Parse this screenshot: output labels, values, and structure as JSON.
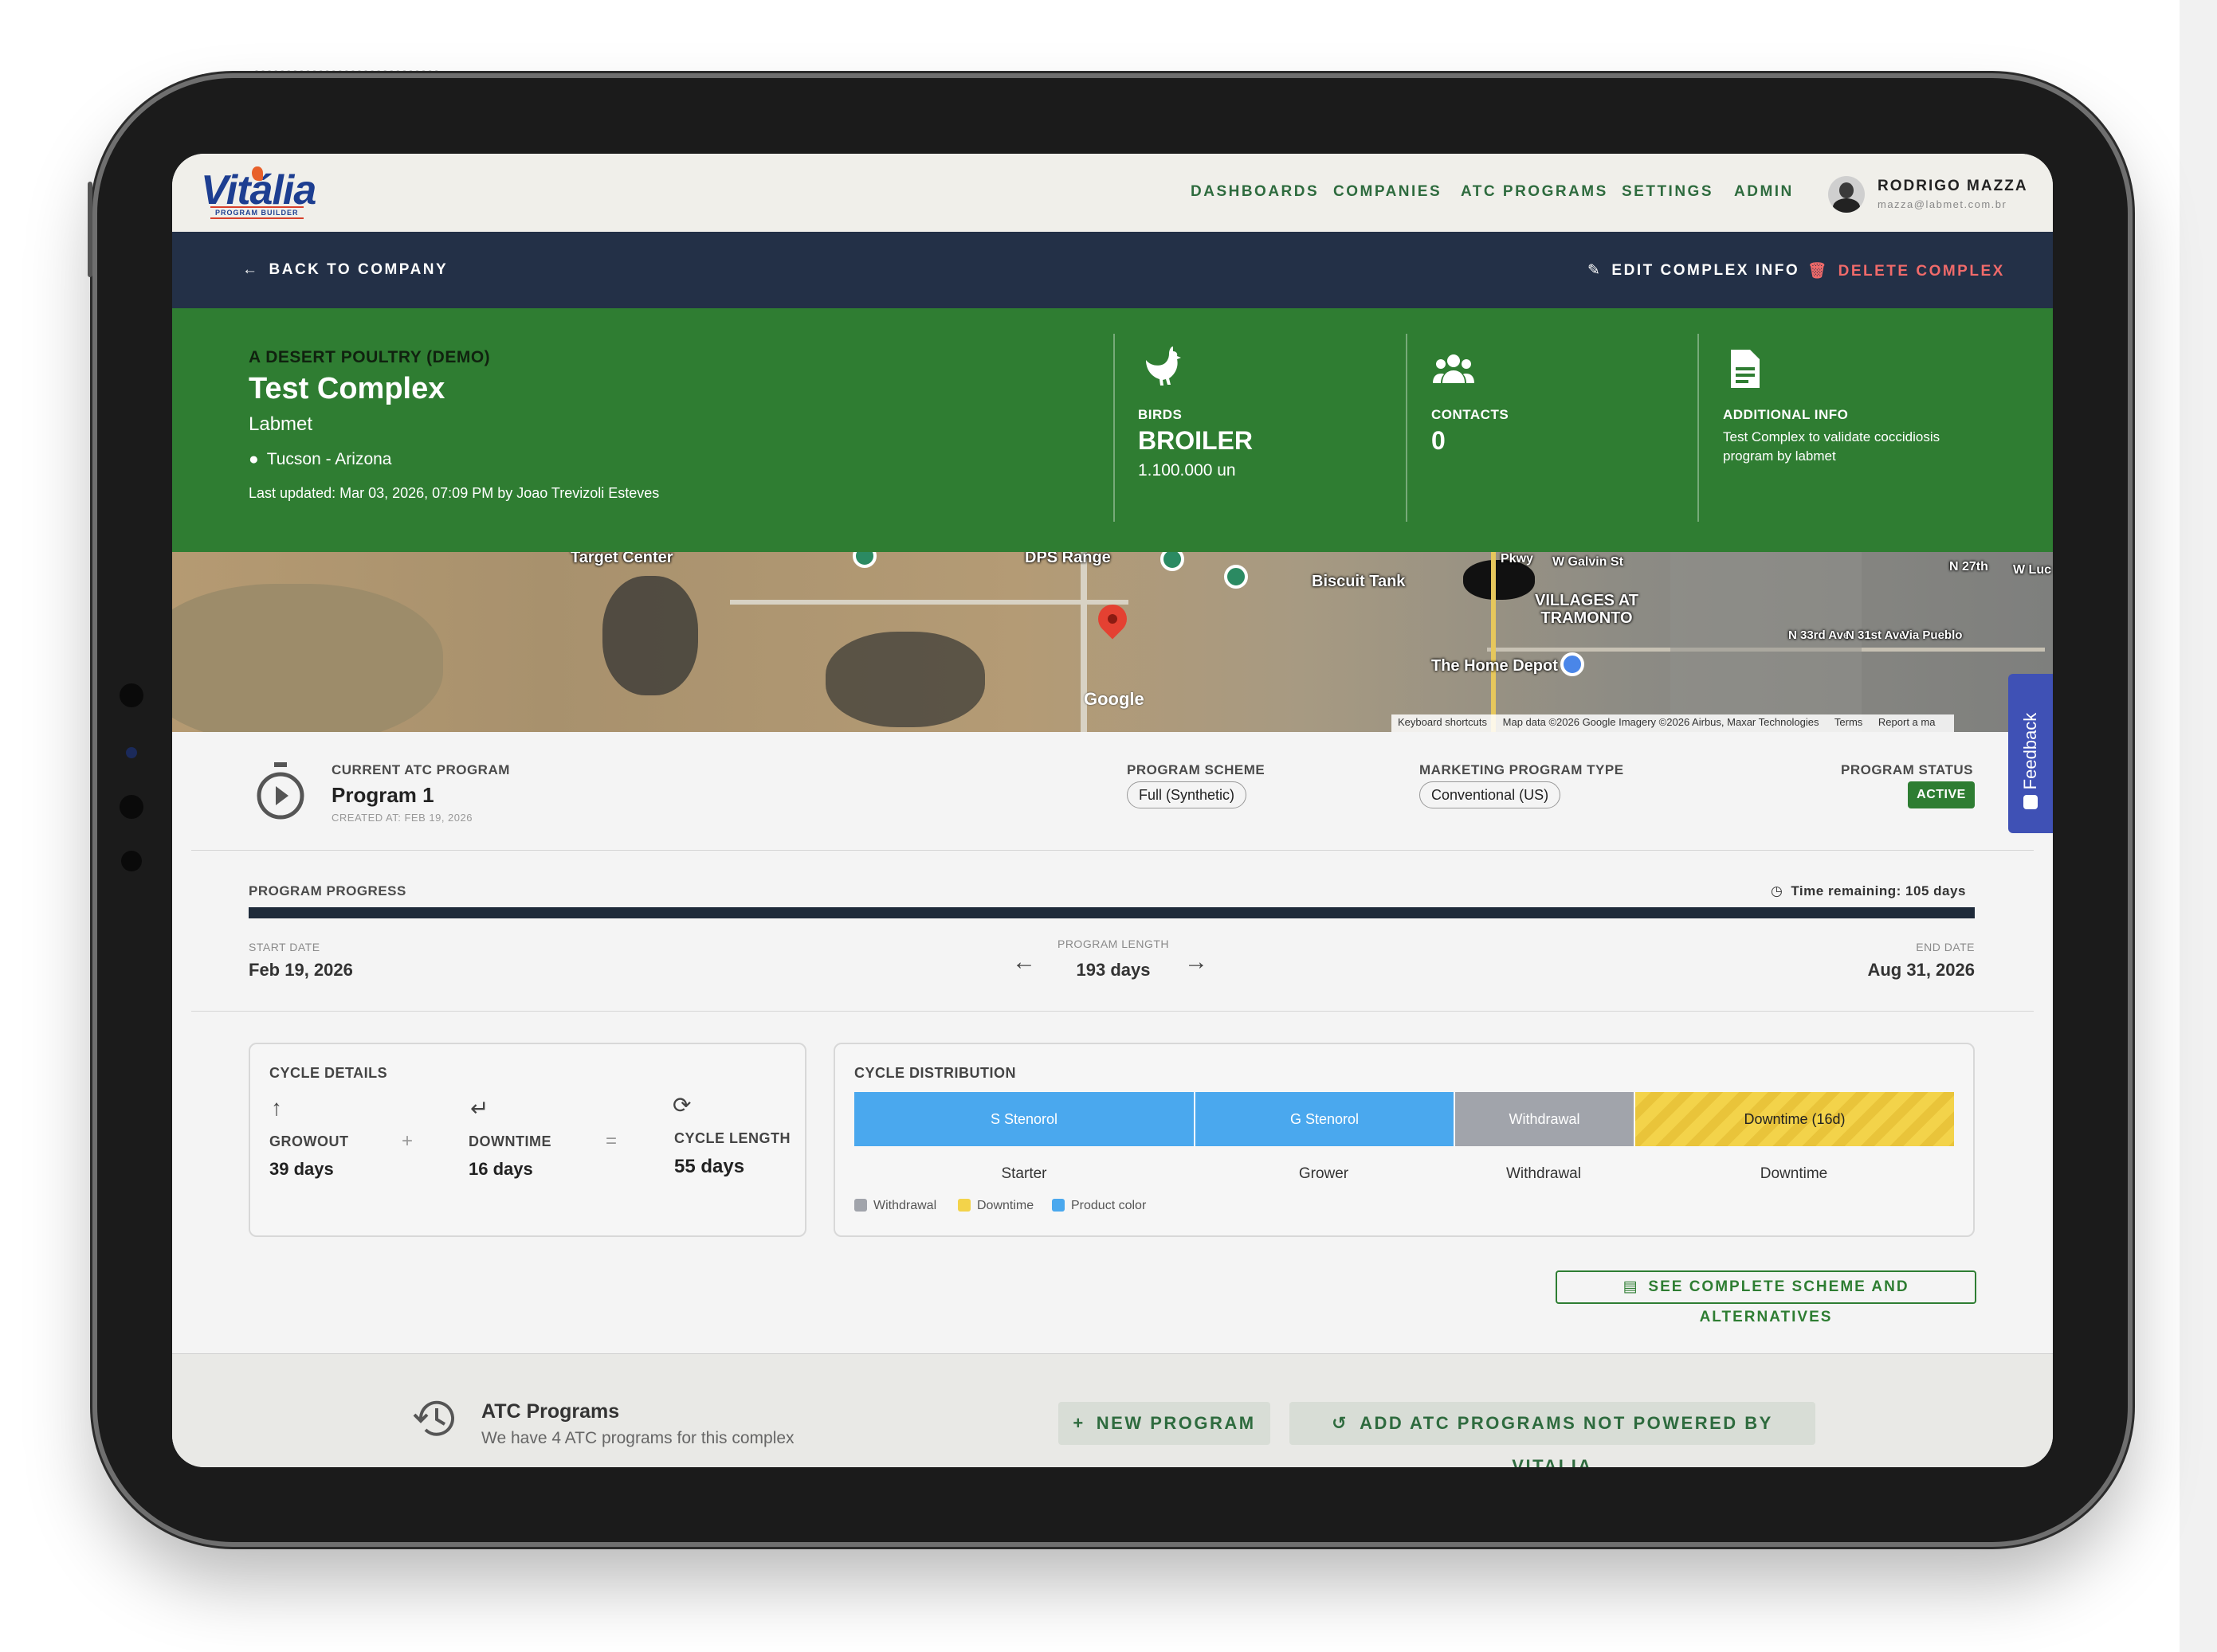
{
  "header": {
    "logo_text": "Vitália",
    "logo_sub": "PROGRAM BUILDER",
    "nav": [
      "DASHBOARDS",
      "COMPANIES",
      "ATC PROGRAMS",
      "SETTINGS",
      "ADMIN"
    ],
    "user_name": "RODRIGO MAZZA",
    "user_email": "mazza@labmet.com.br"
  },
  "actionbar": {
    "back": "BACK TO COMPANY",
    "edit": "EDIT COMPLEX INFO",
    "delete": "DELETE COMPLEX"
  },
  "complex": {
    "company": "A DESERT POULTRY (DEMO)",
    "title": "Test Complex",
    "subtitle": "Labmet",
    "location": "Tucson - Arizona",
    "updated": "Last updated: Mar 03, 2026, 07:09 PM by Joao Trevizoli Esteves",
    "birds_label": "BIRDS",
    "birds_type": "BROILER",
    "birds_count": "1.100.000 un",
    "contacts_label": "CONTACTS",
    "contacts_count": "0",
    "info_label": "ADDITIONAL INFO",
    "info_text": "Test Complex to validate coccidiosis program by labmet"
  },
  "map": {
    "labels": [
      "Target Center",
      "DPS Range",
      "Biscuit Tank",
      "W Galvin St",
      "VILLAGES AT TRAMONTO",
      "The Home Depot",
      "Pkwy",
      "N 27th",
      "W Luc",
      "N 33rd Ave",
      "N 31st Ave",
      "Via Pueblo"
    ],
    "google": "Google",
    "attribution": [
      "Keyboard shortcuts",
      "Map data ©2026 Google Imagery ©2026 Airbus, Maxar Technologies",
      "Terms",
      "Report a ma"
    ]
  },
  "program": {
    "current_label": "CURRENT ATC PROGRAM",
    "name": "Program 1",
    "created": "CREATED AT: FEB 19, 2026",
    "scheme_label": "PROGRAM SCHEME",
    "scheme_value": "Full (Synthetic)",
    "marketing_label": "MARKETING PROGRAM TYPE",
    "marketing_value": "Conventional (US)",
    "status_label": "PROGRAM STATUS",
    "status_value": "ACTIVE",
    "progress_label": "PROGRAM PROGRESS",
    "progress_fraction": 1.0,
    "time_remaining": "Time remaining: 105 days",
    "start_label": "START DATE",
    "start_value": "Feb 19, 2026",
    "length_label": "PROGRAM LENGTH",
    "length_value": "193 days",
    "end_label": "END DATE",
    "end_value": "Aug 31, 2026"
  },
  "cycle_details": {
    "title": "CYCLE DETAILS",
    "growout_label": "GROWOUT",
    "growout_value": "39 days",
    "downtime_label": "DOWNTIME",
    "downtime_value": "16 days",
    "length_label": "CYCLE LENGTH",
    "length_value": "55 days",
    "plus": "+",
    "equals": "="
  },
  "cycle_distribution": {
    "title": "CYCLE DISTRIBUTION",
    "segments": [
      {
        "label": "S Stenorol",
        "phase": "Starter",
        "color": "#4aa8ee"
      },
      {
        "label": "G Stenorol",
        "phase": "Grower",
        "color": "#4aa8ee"
      },
      {
        "label": "Withdrawal",
        "phase": "Withdrawal",
        "color": "#a1a4ab"
      },
      {
        "label": "Downtime (16d)",
        "phase": "Downtime",
        "color": "#f3d34a"
      }
    ],
    "legend": [
      {
        "label": "Withdrawal",
        "color": "#a1a4ab"
      },
      {
        "label": "Downtime",
        "color": "#f3d34a"
      },
      {
        "label": "Product color",
        "color": "#4aa8ee"
      }
    ]
  },
  "see_button": "SEE COMPLETE SCHEME AND ALTERNATIVES",
  "bottom": {
    "title": "ATC Programs",
    "subtitle": "We have 4 ATC programs for this complex",
    "new_program": "NEW PROGRAM",
    "add_programs": "ADD ATC PROGRAMS NOT POWERED BY VITALIA"
  },
  "feedback": "Feedback",
  "colors": {
    "brand_green": "#2f7d32",
    "navy": "#233047",
    "danger": "#f06a6a",
    "feedback": "#3f51b5"
  }
}
